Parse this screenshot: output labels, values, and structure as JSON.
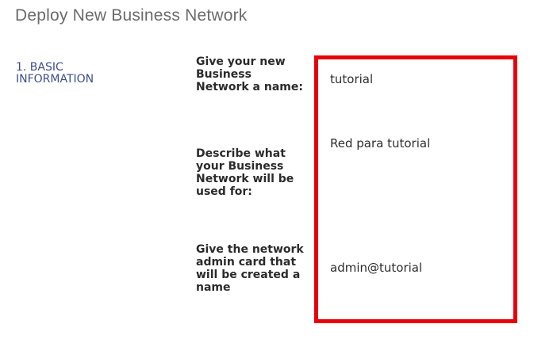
{
  "page": {
    "title": "Deploy New Business Network"
  },
  "sidebar": {
    "section_label": "1. BASIC INFORMATION"
  },
  "form": {
    "name_label": "Give your new Business Network a name:",
    "name_value": "tutorial",
    "description_label": "Describe what your Business Network will be used for:",
    "description_value": "Red para tutorial",
    "card_label": "Give the network admin card that will be created a name",
    "card_value": "admin@tutorial"
  },
  "colors": {
    "highlight": "#e8000b",
    "section_accent": "#3d4f8b"
  }
}
